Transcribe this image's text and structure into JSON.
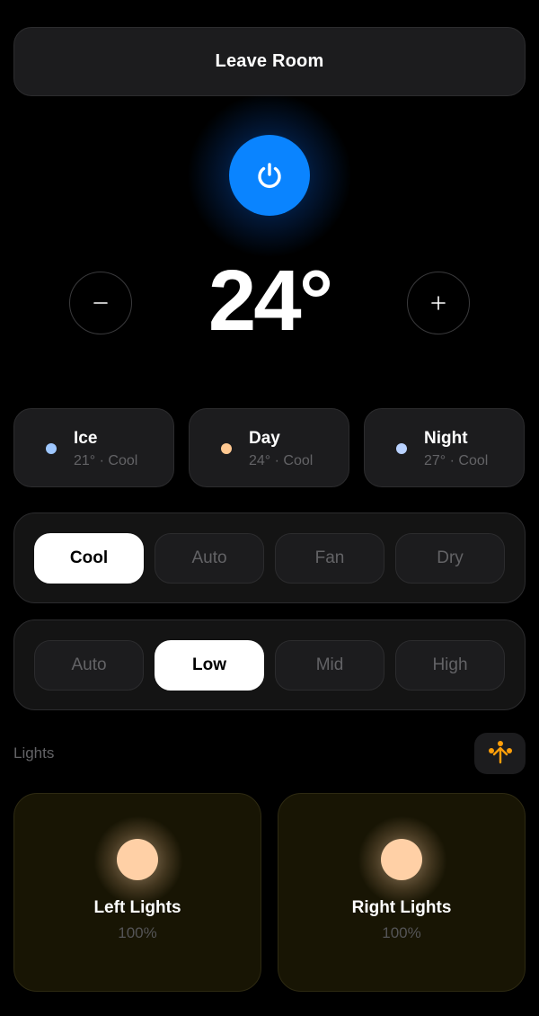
{
  "header": {
    "leave_label": "Leave Room"
  },
  "power": {
    "on": true,
    "color": "#0a84ff"
  },
  "temperature": {
    "display": "24°",
    "value": 24
  },
  "presets": [
    {
      "name": "Ice",
      "sub": "21° · Cool",
      "color": "#9ec7ff"
    },
    {
      "name": "Day",
      "sub": "24° · Cool",
      "color": "#ffc891"
    },
    {
      "name": "Night",
      "sub": "27° · Cool",
      "color": "#b9d2ff"
    }
  ],
  "mode": {
    "options": [
      "Cool",
      "Auto",
      "Fan",
      "Dry"
    ],
    "selected": "Cool"
  },
  "fan": {
    "options": [
      "Auto",
      "Low",
      "Mid",
      "High"
    ],
    "selected": "Low"
  },
  "lights": {
    "section_label": "Lights",
    "scene_icon_color": "#ff9f0a",
    "items": [
      {
        "name": "Left Lights",
        "level": "100%"
      },
      {
        "name": "Right Lights",
        "level": "100%"
      }
    ]
  }
}
